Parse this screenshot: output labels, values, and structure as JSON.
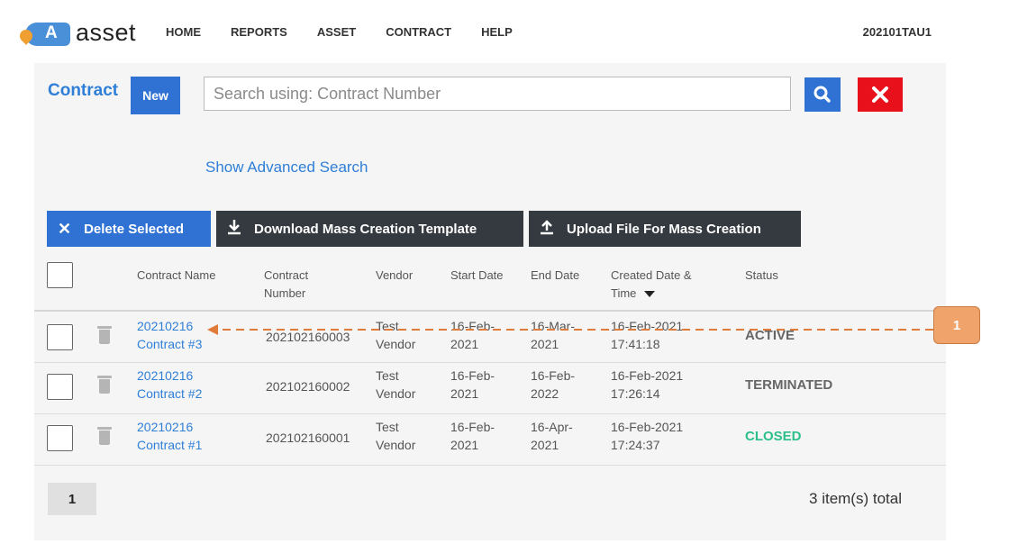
{
  "app": {
    "logo_letter": "A",
    "logo_text": "asset",
    "nav": [
      "HOME",
      "REPORTS",
      "ASSET",
      "CONTRACT",
      "HELP"
    ],
    "user": "202101TAU1"
  },
  "page": {
    "title": "Contract",
    "new_label": "New",
    "search_placeholder": "Search using: Contract Number",
    "advanced_search": "Show Advanced Search"
  },
  "actions": {
    "delete": "Delete Selected",
    "download": "Download Mass Creation Template",
    "upload": "Upload File For Mass Creation"
  },
  "table": {
    "headers": {
      "name": "Contract Name",
      "number_l1": "Contract",
      "number_l2": "Number",
      "vendor": "Vendor",
      "start": "Start Date",
      "end": "End Date",
      "created_l1": "Created Date &",
      "created_l2": "Time",
      "status": "Status"
    },
    "sort_icon": "caret-down-icon",
    "rows": [
      {
        "name1": "20210216",
        "name2": "Contract #3",
        "number": "202102160003",
        "vendor1": "Test",
        "vendor2": "Vendor",
        "start1": "16-Feb-",
        "start2": "2021",
        "end1": "16-Mar-",
        "end2": "2021",
        "created1": "16-Feb-2021",
        "created2": "17:41:18",
        "status": "ACTIVE"
      },
      {
        "name1": "20210216",
        "name2": "Contract #2",
        "number": "202102160002",
        "vendor1": "Test",
        "vendor2": "Vendor",
        "start1": "16-Feb-",
        "start2": "2021",
        "end1": "16-Feb-",
        "end2": "2022",
        "created1": "16-Feb-2021",
        "created2": "17:26:14",
        "status": "TERMINATED"
      },
      {
        "name1": "20210216",
        "name2": "Contract #1",
        "number": "202102160001",
        "vendor1": "Test",
        "vendor2": "Vendor",
        "start1": "16-Feb-",
        "start2": "2021",
        "end1": "16-Apr-",
        "end2": "2021",
        "created1": "16-Feb-2021",
        "created2": "17:24:37",
        "status": "CLOSED"
      }
    ]
  },
  "pagination": {
    "page": "1",
    "total": "3 item(s) total"
  },
  "callout": {
    "number": "1"
  },
  "colors": {
    "accent": "#2f72d4",
    "link": "#2f7fd7",
    "danger": "#e8101a",
    "dark_button": "#343a40",
    "closed": "#2cbf8a",
    "callout": "#f0a36a"
  }
}
